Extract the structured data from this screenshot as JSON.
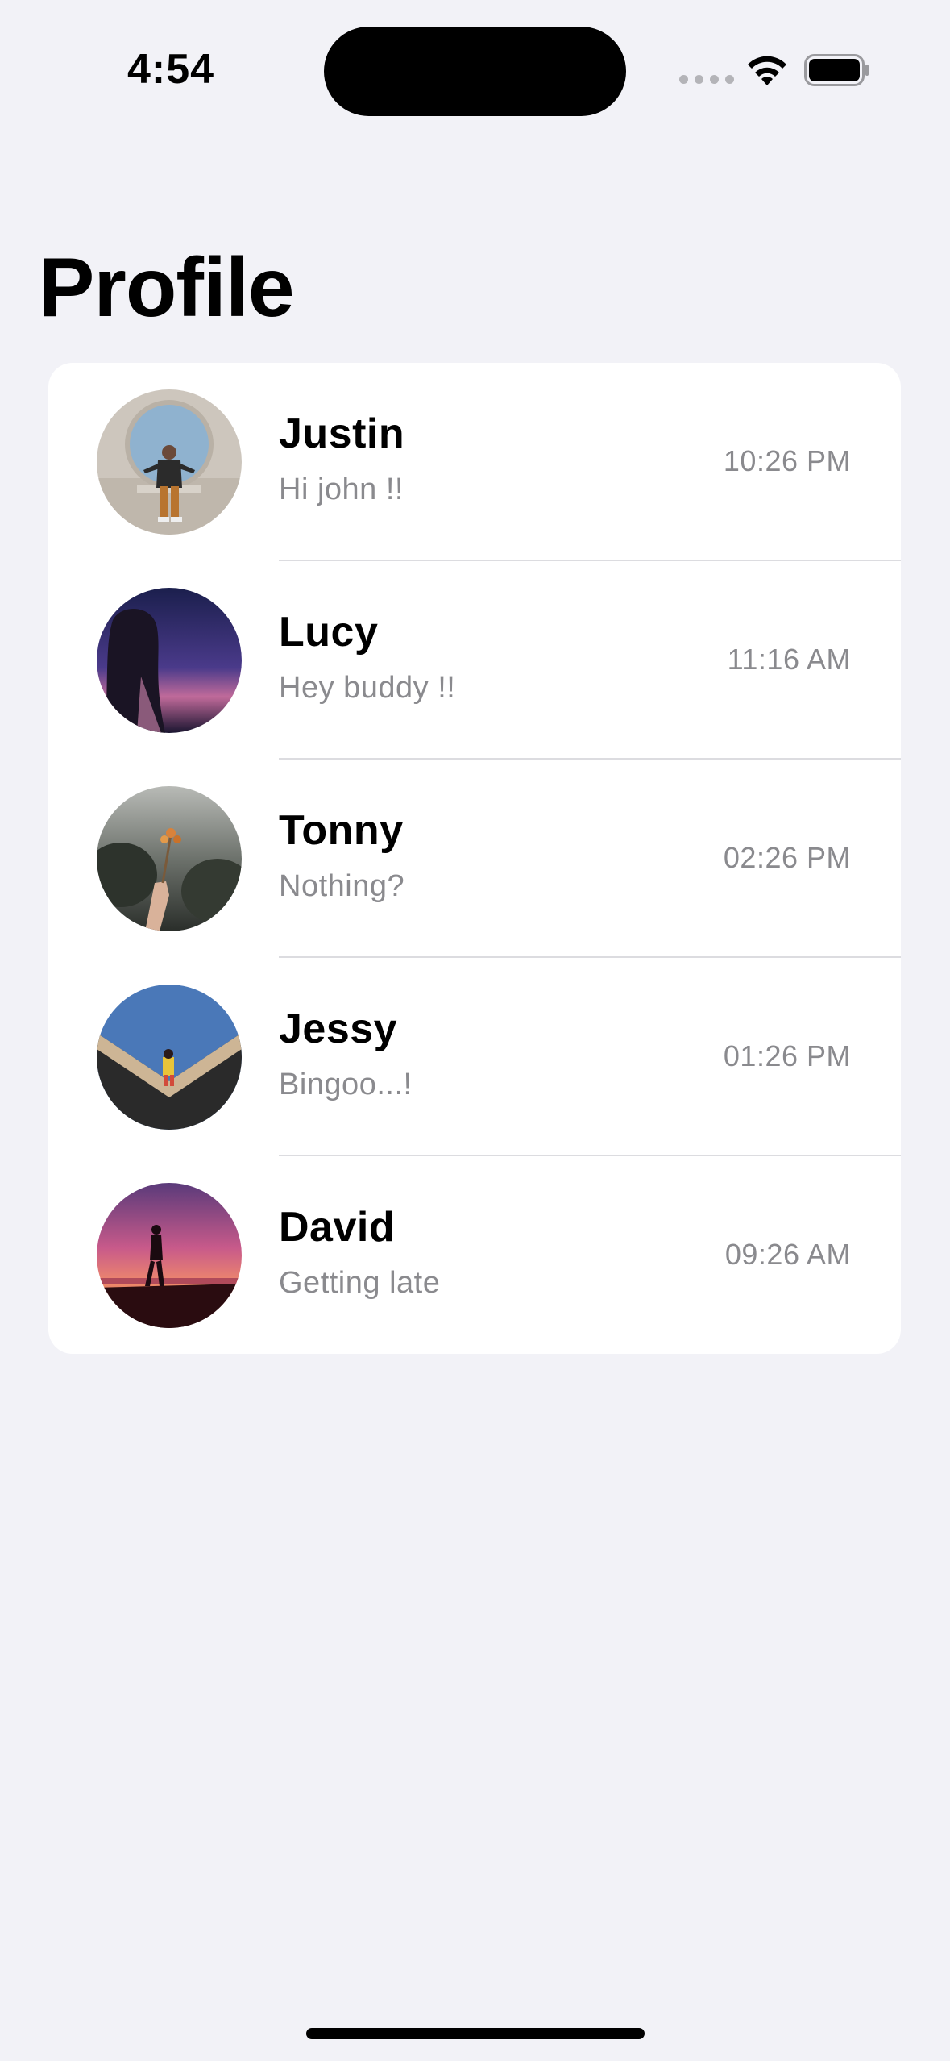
{
  "status_bar": {
    "time": "4:54"
  },
  "page": {
    "title": "Profile"
  },
  "contacts": [
    {
      "name": "Justin",
      "message": "Hi john !!",
      "time": "10:26 PM",
      "avatar": "person-sitting-photo"
    },
    {
      "name": "Lucy",
      "message": "Hey buddy !!",
      "time": "11:16 AM",
      "avatar": "woman-night-sky-photo"
    },
    {
      "name": "Tonny",
      "message": "Nothing?",
      "time": "02:26 PM",
      "avatar": "hand-holding-flowers-photo"
    },
    {
      "name": "Jessy",
      "message": "Bingoo...!",
      "time": "01:26 PM",
      "avatar": "person-on-ramp-photo"
    },
    {
      "name": "David",
      "message": "Getting late",
      "time": "09:26 AM",
      "avatar": "silhouette-sunset-photo"
    }
  ],
  "colors": {
    "background": "#f2f2f7",
    "card": "#ffffff",
    "secondary_text": "#8a8a8e"
  }
}
